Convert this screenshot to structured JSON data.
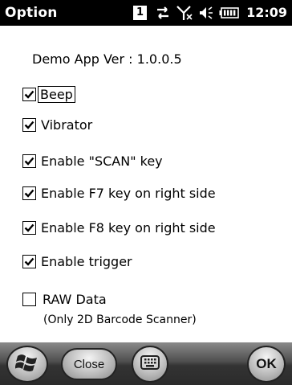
{
  "titlebar": {
    "title": "Option",
    "notification_count": "1",
    "clock": "12:09",
    "icons": [
      "notification-badge-icon",
      "connectivity-icon",
      "no-signal-icon",
      "speaker-icon",
      "battery-icon"
    ]
  },
  "app": {
    "version_text": "Demo App Ver : 1.0.0.5"
  },
  "options": [
    {
      "label": "Beep",
      "checked": true,
      "focused": true
    },
    {
      "label": "Vibrator",
      "checked": true
    },
    {
      "label": "Enable \"SCAN\" key",
      "checked": true
    },
    {
      "label": "Enable F7 key on right side",
      "checked": true
    },
    {
      "label": "Enable F8 key on right side",
      "checked": true
    },
    {
      "label": "Enable trigger",
      "checked": true
    },
    {
      "label": "RAW Data",
      "checked": false
    }
  ],
  "raw_note": "(Only 2D Barcode Scanner)",
  "softkeys": {
    "close_label": "Close",
    "ok_label": "OK",
    "icons": [
      "windows-start-icon",
      "keyboard-icon"
    ]
  }
}
